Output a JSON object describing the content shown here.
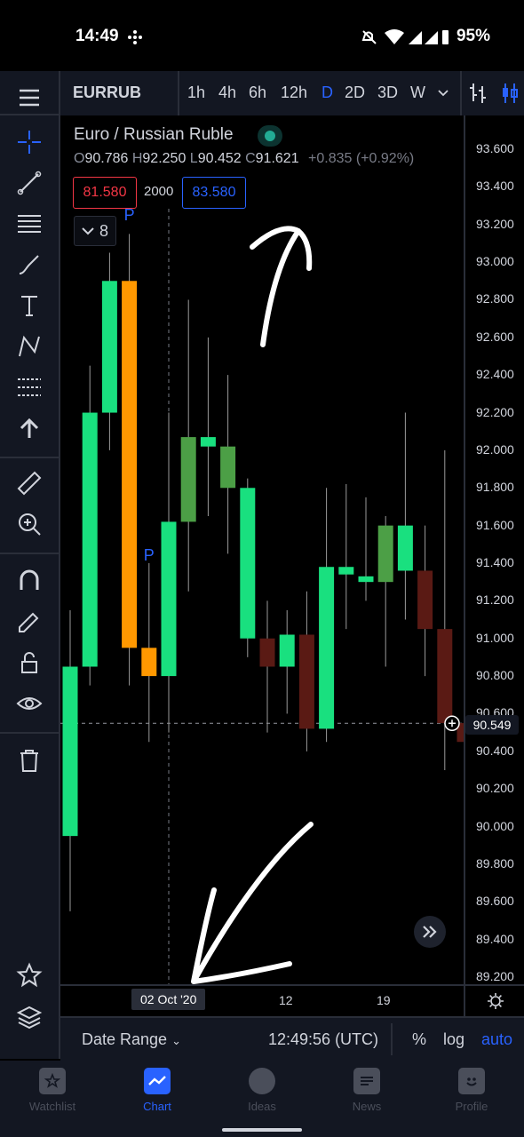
{
  "status_bar": {
    "time": "14:49",
    "battery": "95%"
  },
  "toolbar": {
    "symbol": "EURRUB",
    "intervals": [
      "1h",
      "4h",
      "6h",
      "12h",
      "D",
      "2D",
      "3D",
      "W"
    ],
    "active_interval": "D"
  },
  "legend": {
    "title": "Euro / Russian Ruble",
    "ohlc": {
      "o_label": "O",
      "o": "90.786",
      "h_label": "H",
      "h": "92.250",
      "l_label": "L",
      "l": "90.452",
      "c_label": "C",
      "c": "91.621",
      "change": "+0.835 (+0.92%)"
    },
    "sell_price": "81.580",
    "spread": "2000",
    "buy_price": "83.580",
    "indicator_count": "8"
  },
  "colors": {
    "up": "#22ab94",
    "down": "#f23645",
    "accent": "#2962ff",
    "hl_candle": "#ff9800",
    "background": "#000000"
  },
  "chart_data": {
    "type": "candlestick",
    "price_axis_ticks": [
      "93.600",
      "93.400",
      "93.200",
      "93.000",
      "92.800",
      "92.600",
      "92.400",
      "92.200",
      "92.000",
      "91.800",
      "91.600",
      "91.400",
      "91.200",
      "91.000",
      "90.800",
      "90.600",
      "90.400",
      "90.200",
      "90.000",
      "89.800",
      "89.600",
      "89.400",
      "89.200"
    ],
    "ylim": [
      89.2,
      93.6
    ],
    "last_price": "90.549",
    "time_axis": {
      "crosshair_date": "02 Oct '20",
      "labels": [
        "12",
        "19"
      ]
    },
    "markers": [
      "P",
      "P"
    ],
    "candles": [
      {
        "o": 89.95,
        "h": 91.15,
        "l": 89.55,
        "c": 90.85,
        "color": "up"
      },
      {
        "o": 90.85,
        "h": 92.45,
        "l": 90.75,
        "c": 92.2,
        "color": "up"
      },
      {
        "o": 92.2,
        "h": 93.05,
        "l": 92.0,
        "c": 92.9,
        "color": "up"
      },
      {
        "o": 92.9,
        "h": 93.15,
        "l": 90.75,
        "c": 90.95,
        "color": "highlight"
      },
      {
        "o": 90.95,
        "h": 91.4,
        "l": 90.45,
        "c": 90.8,
        "color": "highlight"
      },
      {
        "o": 90.8,
        "h": 92.2,
        "l": 90.5,
        "c": 91.62,
        "color": "up"
      },
      {
        "o": 91.62,
        "h": 92.8,
        "l": 91.25,
        "c": 92.07,
        "color": "up_dim"
      },
      {
        "o": 92.02,
        "h": 92.6,
        "l": 91.65,
        "c": 92.07,
        "color": "up"
      },
      {
        "o": 92.02,
        "h": 92.4,
        "l": 91.45,
        "c": 91.8,
        "color": "up_dim"
      },
      {
        "o": 91.8,
        "h": 91.85,
        "l": 90.9,
        "c": 91.0,
        "color": "up"
      },
      {
        "o": 91.0,
        "h": 91.2,
        "l": 90.5,
        "c": 90.85,
        "color": "down"
      },
      {
        "o": 90.85,
        "h": 91.15,
        "l": 90.6,
        "c": 91.02,
        "color": "up"
      },
      {
        "o": 91.02,
        "h": 91.25,
        "l": 90.4,
        "c": 90.52,
        "color": "down"
      },
      {
        "o": 90.52,
        "h": 91.8,
        "l": 90.45,
        "c": 91.38,
        "color": "up"
      },
      {
        "o": 91.38,
        "h": 91.82,
        "l": 91.05,
        "c": 91.34,
        "color": "up"
      },
      {
        "o": 91.3,
        "h": 91.75,
        "l": 91.2,
        "c": 91.33,
        "color": "up"
      },
      {
        "o": 91.3,
        "h": 91.65,
        "l": 90.85,
        "c": 91.6,
        "color": "up_dim"
      },
      {
        "o": 91.6,
        "h": 92.2,
        "l": 91.1,
        "c": 91.36,
        "color": "up"
      },
      {
        "o": 91.36,
        "h": 91.6,
        "l": 90.8,
        "c": 91.05,
        "color": "down"
      },
      {
        "o": 91.05,
        "h": 92.0,
        "l": 90.3,
        "c": 90.55,
        "color": "down"
      },
      {
        "o": 90.55,
        "h": 90.75,
        "l": 90.4,
        "c": 90.45,
        "color": "down"
      }
    ]
  },
  "bottom_bar": {
    "date_range": "Date Range",
    "clock": "12:49:56 (UTC)",
    "percent": "%",
    "log": "log",
    "auto": "auto"
  },
  "nav": {
    "items": [
      "Watchlist",
      "Chart",
      "Ideas",
      "News",
      "Profile"
    ],
    "active": "Chart"
  }
}
